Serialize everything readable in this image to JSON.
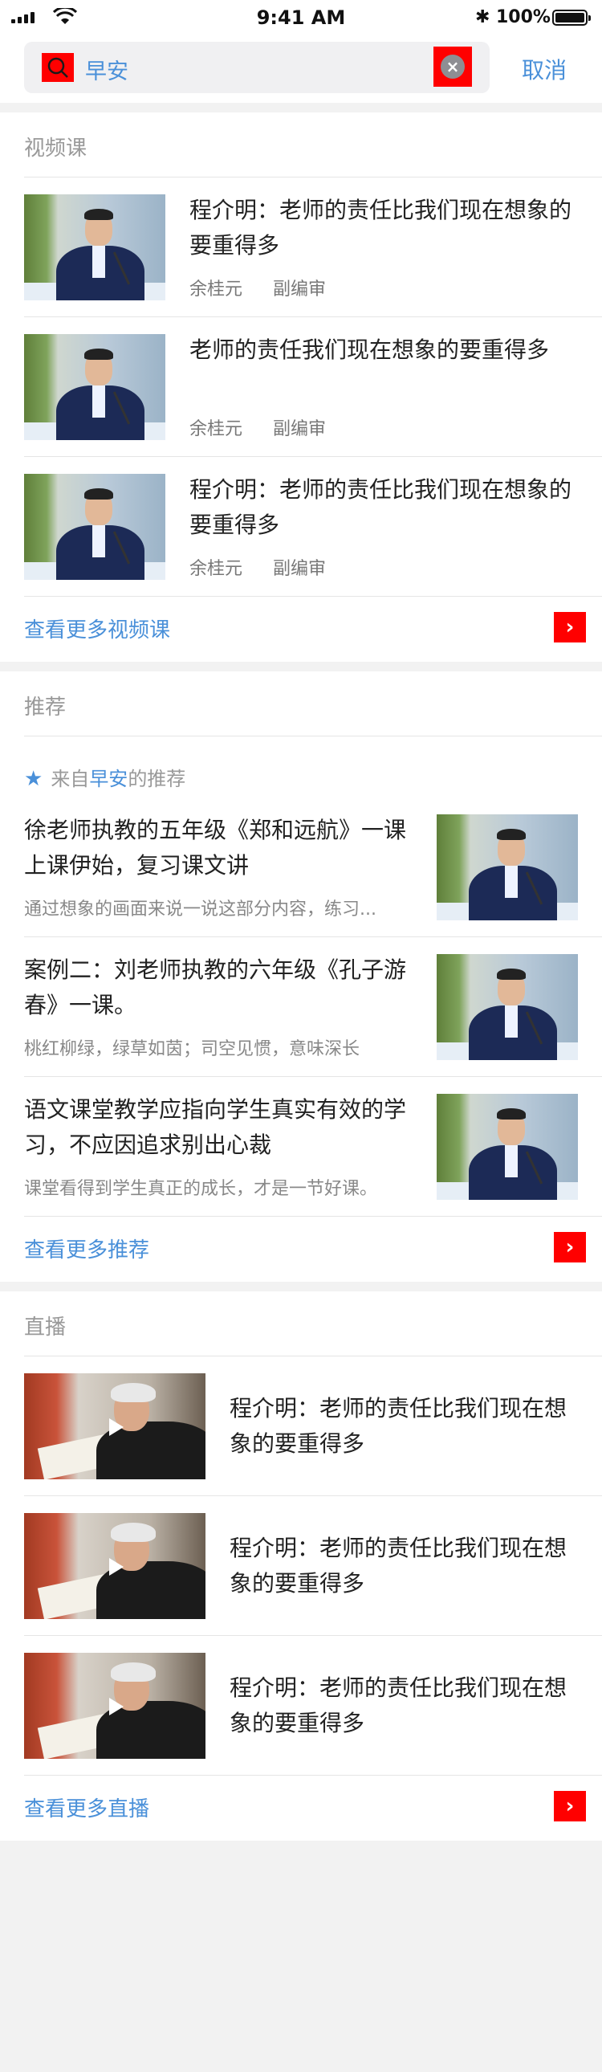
{
  "status_bar": {
    "time": "9:41 AM",
    "battery": "100%"
  },
  "search": {
    "query": "早安",
    "cancel_label": "取消"
  },
  "video_section": {
    "title": "视频课",
    "items": [
      {
        "title": "程介明：老师的责任比我们现在想象的要重得多",
        "author": "余桂元",
        "role": "副编审"
      },
      {
        "title": "老师的责任我们现在想象的要重得多",
        "author": "余桂元",
        "role": "副编审"
      },
      {
        "title": "程介明：老师的责任比我们现在想象的要重得多",
        "author": "余桂元",
        "role": "副编审"
      }
    ],
    "more_label": "查看更多视频课"
  },
  "recommend_section": {
    "title": "推荐",
    "from_prefix": "来自",
    "from_keyword": "早安",
    "from_suffix": "的推荐",
    "items": [
      {
        "title": "徐老师执教的五年级《郑和远航》一课上课伊始，复习课文讲",
        "desc": "通过想象的画面来说一说这部分内容，练习..."
      },
      {
        "title": "案例二：刘老师执教的六年级《孔子游春》一课。",
        "desc": "桃红柳绿，绿草如茵；司空见惯，意味深长"
      },
      {
        "title": "语文课堂教学应指向学生真实有效的学习，不应因追求别出心裁",
        "desc": "课堂看得到学生真正的成长，才是一节好课。"
      }
    ],
    "more_label": "查看更多推荐"
  },
  "live_section": {
    "title": "直播",
    "items": [
      {
        "title": "程介明：老师的责任比我们现在想象的要重得多"
      },
      {
        "title": "程介明：老师的责任比我们现在想象的要重得多"
      },
      {
        "title": "程介明：老师的责任比我们现在想象的要重得多"
      }
    ],
    "more_label": "查看更多直播"
  }
}
